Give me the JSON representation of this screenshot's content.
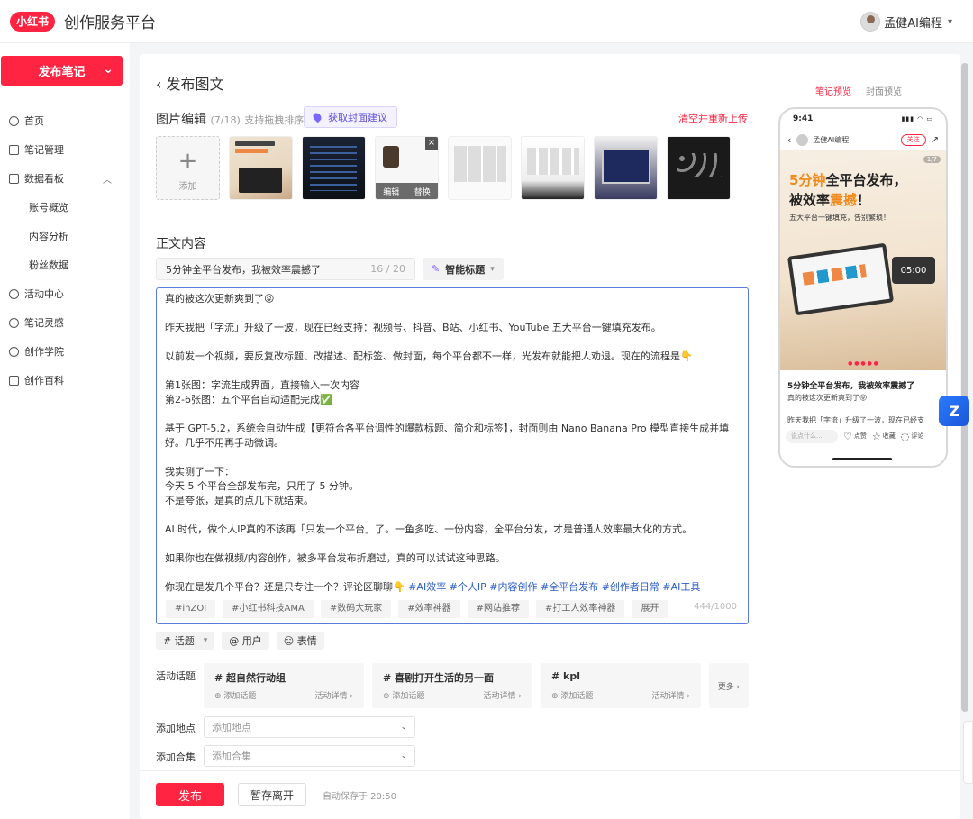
{
  "app": {
    "logo": "小红书",
    "title": "创作服务平台",
    "user": "孟健AI编程"
  },
  "sidebar": {
    "publish_btn": "发布笔记",
    "items": [
      {
        "label": "首页"
      },
      {
        "label": "笔记管理"
      },
      {
        "label": "数据看板"
      },
      {
        "label": "账号概览"
      },
      {
        "label": "内容分析"
      },
      {
        "label": "粉丝数据"
      },
      {
        "label": "活动中心"
      },
      {
        "label": "笔记灵感"
      },
      {
        "label": "创作学院"
      },
      {
        "label": "创作百科"
      }
    ]
  },
  "page": {
    "back_title": "发布图文",
    "image_section": {
      "title": "图片编辑",
      "count": "(7/18)",
      "hint": "支持拖拽排序",
      "cover_tip": "获取封面建议",
      "clear": "清空并重新上传",
      "add": "添加",
      "edit": "编辑",
      "replace": "替换"
    },
    "body_section": {
      "title": "正文内容"
    },
    "title_input": {
      "value": "5分钟全平台发布，我被效率震撼了",
      "count": "16 / 20"
    },
    "smart_title": "智能标题",
    "editor": {
      "lines": [
        "真的被这次更新爽到了😝",
        "",
        "昨天我把「字流」升级了一波，现在已经支持：视频号、抖音、B站、小红书、YouTube 五大平台一键填充发布。",
        "",
        "以前发一个视频，要反复改标题、改描述、配标签、做封面，每个平台都不一样，光发布就能把人劝退。现在的流程是👇",
        "",
        "第1张图：字流生成界面，直接输入一次内容",
        "第2-6张图：五个平台自动适配完成✅",
        "",
        "基于 GPT-5.2，系统会自动生成【更符合各平台调性的爆款标题、简介和标签】，封面则由 Nano Banana Pro 模型直接生成并填好。几乎不用再手动微调。",
        "",
        "我实测了一下：",
        "今天 5 个平台全部发布完，只用了 5 分钟。",
        "不是夸张，是真的点几下就结束。",
        "",
        "AI 时代，做个人IP真的不该再「只发一个平台」了。一鱼多吃、一份内容，全平台分发，才是普通人效率最大化的方式。",
        "",
        "如果你也在做视频/内容创作，被多平台发布折磨过，真的可以试试这种思路。",
        ""
      ],
      "last_line": "你现在是发几个平台？还是只专注一个？评论区聊聊👇",
      "hashtags": "#AI效率 #个人IP #内容创作 #全平台发布 #创作者日常 #AI工具",
      "tag_suggestions": [
        "#inZOI",
        "#小红书科技AMA",
        "#数码大玩家",
        "#效率神器",
        "#网站推荐",
        "#打工人效率神器",
        "展开"
      ],
      "count": "444/1000"
    },
    "tools": {
      "topic": "# 话题",
      "user": "@ 用户",
      "emoji": "☺ 表情"
    },
    "activity": {
      "label": "活动话题",
      "cards": [
        {
          "name": "# 超自然行动组",
          "add": "⊕ 添加话题",
          "detail": "活动详情 ›"
        },
        {
          "name": "# 喜剧打开生活的另一面",
          "add": "⊕ 添加话题",
          "detail": "活动详情 ›"
        },
        {
          "name": "# kpl",
          "add": "⊕ 添加话题",
          "detail": "活动详情 ›"
        }
      ],
      "more": "更多 ›"
    },
    "location": {
      "label": "添加地点",
      "placeholder": "添加地点"
    },
    "collection": {
      "label": "添加合集",
      "placeholder": "添加合集"
    },
    "footer": {
      "publish": "发布",
      "draft": "暂存离开",
      "autosave": "自动保存于 20:50"
    }
  },
  "preview": {
    "tabs": [
      "笔记预览",
      "封面预览"
    ],
    "time": "9:41",
    "author": "孟健AI编程",
    "follow": "关注",
    "page_indicator": "1/7",
    "headline_1": "5分钟",
    "headline_2": "全平台发布，",
    "headline_3": "被效率",
    "headline_4": "震撼",
    "headline_5": "！",
    "subhead": "五大平台一键填充，告别繁琐！",
    "clock": "05:00",
    "note_title": "5分钟全平台发布，我被效率震撼了",
    "note_text": "真的被这次更新爽到了😝",
    "note_text2": "昨天我把「字流」升级了一波，现在已经支",
    "comment_placeholder": "说点什么...",
    "like": "点赞",
    "collect": "收藏",
    "comment": "评论"
  },
  "colors": {
    "brand": "#ff2442",
    "accent": "#5b4bd9"
  }
}
